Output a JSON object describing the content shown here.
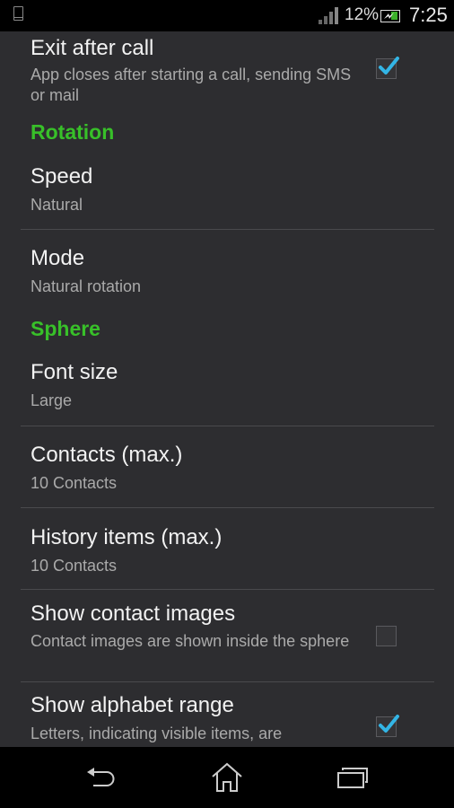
{
  "status_bar": {
    "device_icon": "phone-outline-icon",
    "signal_icon": "signal-bars-icon",
    "battery_percent": "12%",
    "battery_icon": "battery-charging-icon",
    "time": "7:25"
  },
  "colors": {
    "background": "#2d2d30",
    "category": "#38c029",
    "checkbox_accent": "#33b5e5",
    "title": "#f2f2f2",
    "summary": "#aaaaaa"
  },
  "settings": {
    "exit_after_call": {
      "title": "Exit after call",
      "summary": "App closes after starting a call, sending SMS or mail",
      "checked": true
    },
    "rotation_category": "Rotation",
    "speed": {
      "title": "Speed",
      "summary": "Natural"
    },
    "mode": {
      "title": "Mode",
      "summary": "Natural rotation"
    },
    "sphere_category": "Sphere",
    "font_size": {
      "title": "Font size",
      "summary": "Large"
    },
    "contacts_max": {
      "title": "Contacts (max.)",
      "summary": "10 Contacts"
    },
    "history_max": {
      "title": "History items (max.)",
      "summary": "10 Contacts"
    },
    "show_contact_images": {
      "title": "Show contact images",
      "summary": "Contact images are shown inside the sphere",
      "checked": false
    },
    "show_alphabet_range": {
      "title": "Show alphabet range",
      "summary": "Letters, indicating visible items, are",
      "checked": true
    }
  },
  "nav_bar": {
    "back": "back-icon",
    "home": "home-icon",
    "recents": "recents-icon"
  }
}
